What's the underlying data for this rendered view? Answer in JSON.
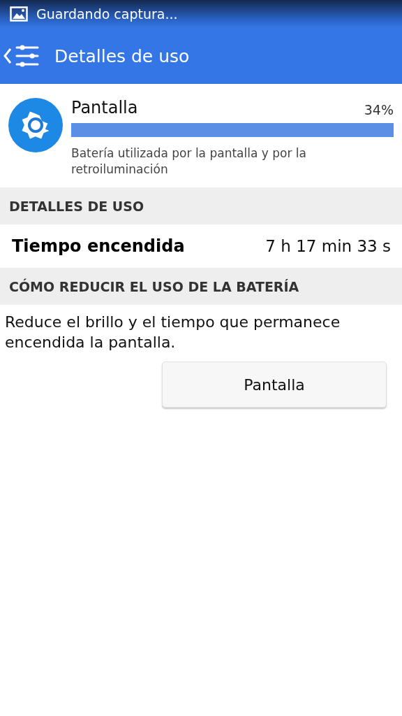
{
  "status_bar": {
    "notification": "Guardando captura..."
  },
  "app_bar": {
    "title": "Detalles de uso"
  },
  "usage": {
    "name": "Pantalla",
    "percent": "34%",
    "level": 1,
    "description": "Batería utilizada por la pantalla y por la retroiluminación"
  },
  "sections": [
    {
      "header": "DETALLES DE USO",
      "kind": "detail",
      "label": "Tiempo encendida",
      "value": "7 h 17 min 33 s"
    },
    {
      "header": "CÓMO REDUCIR EL USO DE LA BATERÍA",
      "kind": "tip",
      "text": "Reduce el brillo y el tiempo que permanece encendida la pantalla.",
      "button": "Pantalla"
    }
  ]
}
